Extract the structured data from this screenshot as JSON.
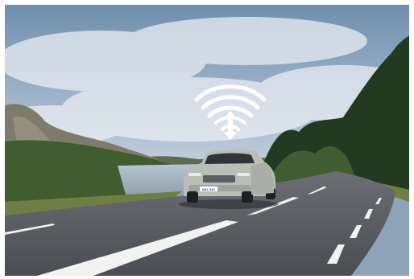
{
  "scene": {
    "subject": "car-on-road",
    "overlay_icon": "wifi-update-icon",
    "colors": {
      "sky_top": "#6f8fae",
      "sky_bottom": "#c6d2df",
      "cloud": "#e9eef3",
      "hills": "#5e6b52",
      "rock": "#8a8577",
      "trees_dark": "#223a1f",
      "trees_mid": "#3f5d2f",
      "grass": "#6e7f43",
      "water": "#a9b9c6",
      "road": "#55585c",
      "road_light": "#6b6e72",
      "lane_marking": "#f2f2f2",
      "car_body": "#b9bfb6",
      "overlay_icon": "#ffffff"
    }
  },
  "car": {
    "plate_text": "SKL 512"
  }
}
